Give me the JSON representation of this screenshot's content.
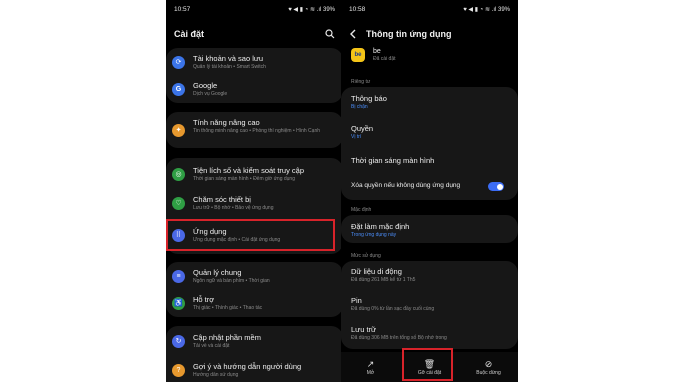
{
  "left_screen": {
    "status_time": "10:57",
    "status_icons": "♥ ◀ ▮ ◔ ≋ .ıl 39%",
    "title": "Cài đặt",
    "rows": [
      {
        "title": "Tài khoản và sao lưu",
        "subtitle": "Quản lý tài khoản • Smart Switch",
        "icon": "sync-icon",
        "color": "#3b74e8"
      },
      {
        "title": "Google",
        "subtitle": "Dịch vụ Google",
        "icon": "google-icon",
        "color": "#3b74e8"
      },
      {
        "title": "Tính năng nâng cao",
        "subtitle": "Tin thông minh nâng cao • Phòng thí nghiệm • Hình Cạnh",
        "icon": "advanced-icon",
        "color": "#e6982e"
      },
      {
        "title": "Tiện lích số và kiểm soát truy cập",
        "subtitle": "Thời gian sáng màn hình • Đếm giờ ứng dụng",
        "icon": "wellbeing-icon",
        "color": "#2f9e44"
      },
      {
        "title": "Chăm sóc thiết bị",
        "subtitle": "Lưu trữ • Bộ nhớ • Bảo vệ ứng dụng",
        "icon": "device-care-icon",
        "color": "#2f9e44"
      },
      {
        "title": "Ứng dụng",
        "subtitle": "Ứng dụng mặc định • Cài đặt ứng dụng",
        "icon": "apps-icon",
        "color": "#4a68e6"
      },
      {
        "title": "Quản lý chung",
        "subtitle": "Ngôn ngữ và bàn phím • Thời gian",
        "icon": "general-management-icon",
        "color": "#4a68e6"
      },
      {
        "title": "Hỗ trợ",
        "subtitle": "Thị giác • Thính giác • Thao tác",
        "icon": "accessibility-icon",
        "color": "#2f9e44"
      },
      {
        "title": "Cập nhật phần mềm",
        "subtitle": "Tải về và cài đặt",
        "icon": "software-update-icon",
        "color": "#4a68e6"
      },
      {
        "title": "Gợi ý và hướng dẫn người dùng",
        "subtitle": "Hướng dẫn sử dụng",
        "icon": "tips-icon",
        "color": "#e6982e"
      }
    ]
  },
  "right_screen": {
    "status_time": "10:58",
    "status_icons": "♥ ◀ ▮ ◔ ≋ .ıl 39%",
    "title": "Thông tin ứng dụng",
    "app_name": "be",
    "app_status": "Đã cài đặt",
    "section_privacy": "Riêng tư",
    "notifications_title": "Thông báo",
    "notifications_sub": "Bị chặn",
    "permissions_title": "Quyền",
    "permissions_sub": "Vị trí",
    "screen_time_title": "Thời gian sáng màn hình",
    "remove_permissions_title": "Xóa quyền nếu không dùng ứng dụng",
    "section_default": "Mặc định",
    "set_default_title": "Đặt làm mặc định",
    "set_default_sub": "Trong ứng dụng này",
    "section_usage": "Mức sử dụng",
    "mobile_data_title": "Dữ liệu di động",
    "mobile_data_sub": "Đã dùng 261 MB kể từ 1 Th5",
    "battery_title": "Pin",
    "battery_sub": "Đã dùng 0% từ lần sạc đầy cuối cùng",
    "storage_title": "Lưu trữ",
    "storage_sub": "Đã dùng 306 MB trên tổng số Bộ nhớ trong",
    "btn_open": "Mở",
    "btn_uninstall": "Gỡ cài đặt",
    "btn_force_stop": "Buộc dừng"
  },
  "colors": {
    "highlight": "#d8232a",
    "link": "#4b8df8",
    "toggle": "#3b6cf4"
  }
}
